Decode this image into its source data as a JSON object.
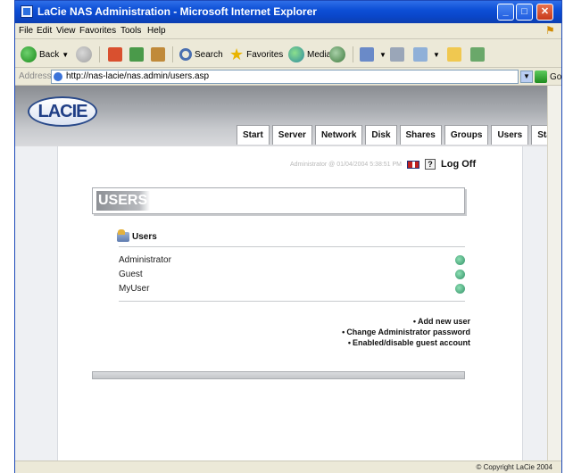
{
  "window": {
    "title": "LaCie NAS Administration - Microsoft Internet Explorer"
  },
  "menu": [
    "File",
    "Edit",
    "View",
    "Favorites",
    "Tools",
    "Help"
  ],
  "toolbar": {
    "back_label": "Back",
    "search_label": "Search",
    "favorites_label": "Favorites",
    "media_label": "Media"
  },
  "address": {
    "label": "Address",
    "url": "http://nas-lacie/nas.admin/users.asp",
    "go_label": "Go"
  },
  "site": {
    "logo": "LACIE",
    "nav_tabs": [
      "Start",
      "Server",
      "Network",
      "Disk",
      "Shares",
      "Groups",
      "Users",
      "Status"
    ],
    "status_line": "Administrator @ 01/04/2004 5:38:51 PM",
    "help_glyph": "?",
    "log_off": "Log Off"
  },
  "page": {
    "heading": "USERS",
    "section_title": "Users",
    "users": [
      "Administrator",
      "Guest",
      "MyUser"
    ],
    "actions": [
      "Add new user",
      "Change Administrator password",
      "Enabled/disable guest account"
    ],
    "copyright": "© Copyright LaCie 2004"
  }
}
